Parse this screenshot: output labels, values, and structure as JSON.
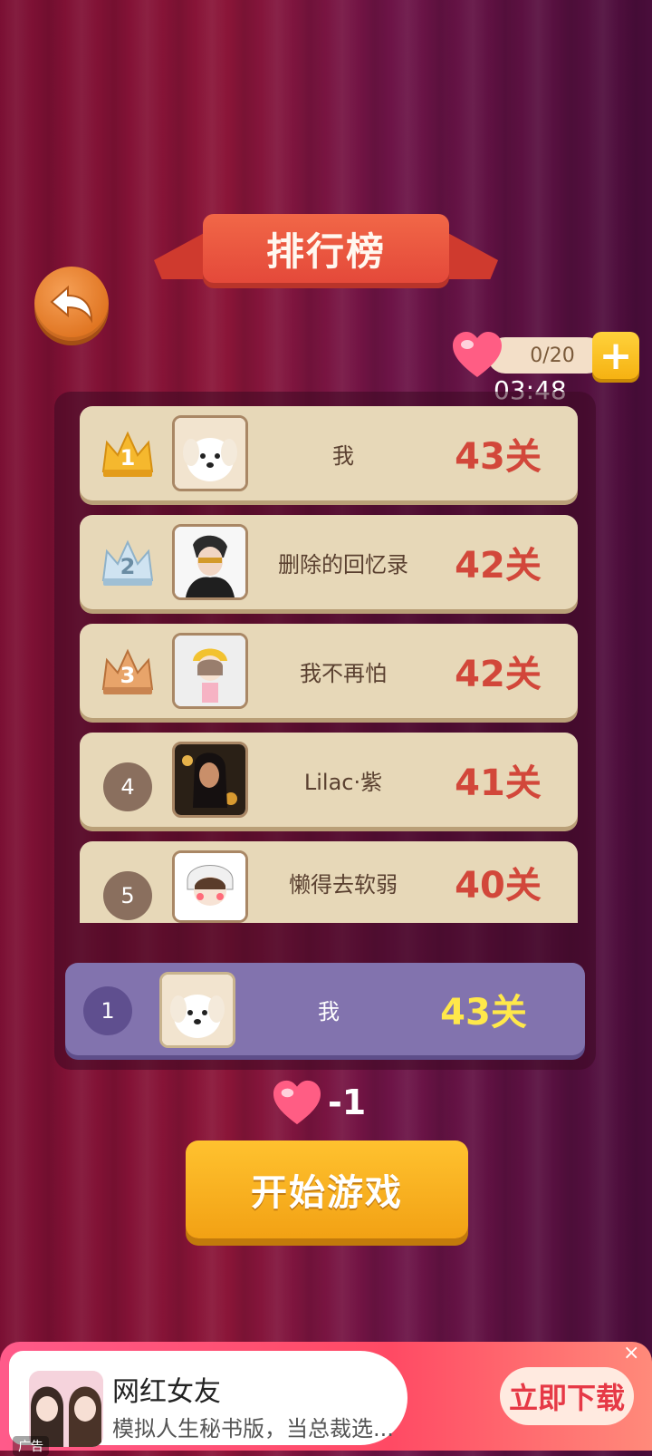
{
  "title": "排行榜",
  "hearts": {
    "count": "0/20",
    "timer": "03:48"
  },
  "leaderboard": [
    {
      "rank": "1",
      "rank_style": "gold-crown",
      "name": "我",
      "score": "43关"
    },
    {
      "rank": "2",
      "rank_style": "silver-crown",
      "name": "删除的回忆录",
      "score": "42关"
    },
    {
      "rank": "3",
      "rank_style": "bronze-crown",
      "name": "我不再怕",
      "score": "42关"
    },
    {
      "rank": "4",
      "rank_style": "circle",
      "name": "Lilac·紫",
      "score": "41关"
    },
    {
      "rank": "5",
      "rank_style": "circle",
      "name": "懒得去软弱",
      "score": "40关"
    }
  ],
  "my_rank": {
    "rank": "1",
    "name": "我",
    "score": "43关"
  },
  "cost": "-1",
  "start_button": "开始游戏",
  "ad": {
    "title": "网红女友",
    "subtitle": "模拟人生秘书版，当总裁选...",
    "tag": "广告",
    "download": "立即下载",
    "close": "×"
  },
  "colors": {
    "score_red": "#d2473a",
    "my_score_yellow": "#ffe84a",
    "row_bg": "#e7d8b8",
    "my_row_bg": "#8273ae",
    "start_button": "#f6b21a"
  }
}
